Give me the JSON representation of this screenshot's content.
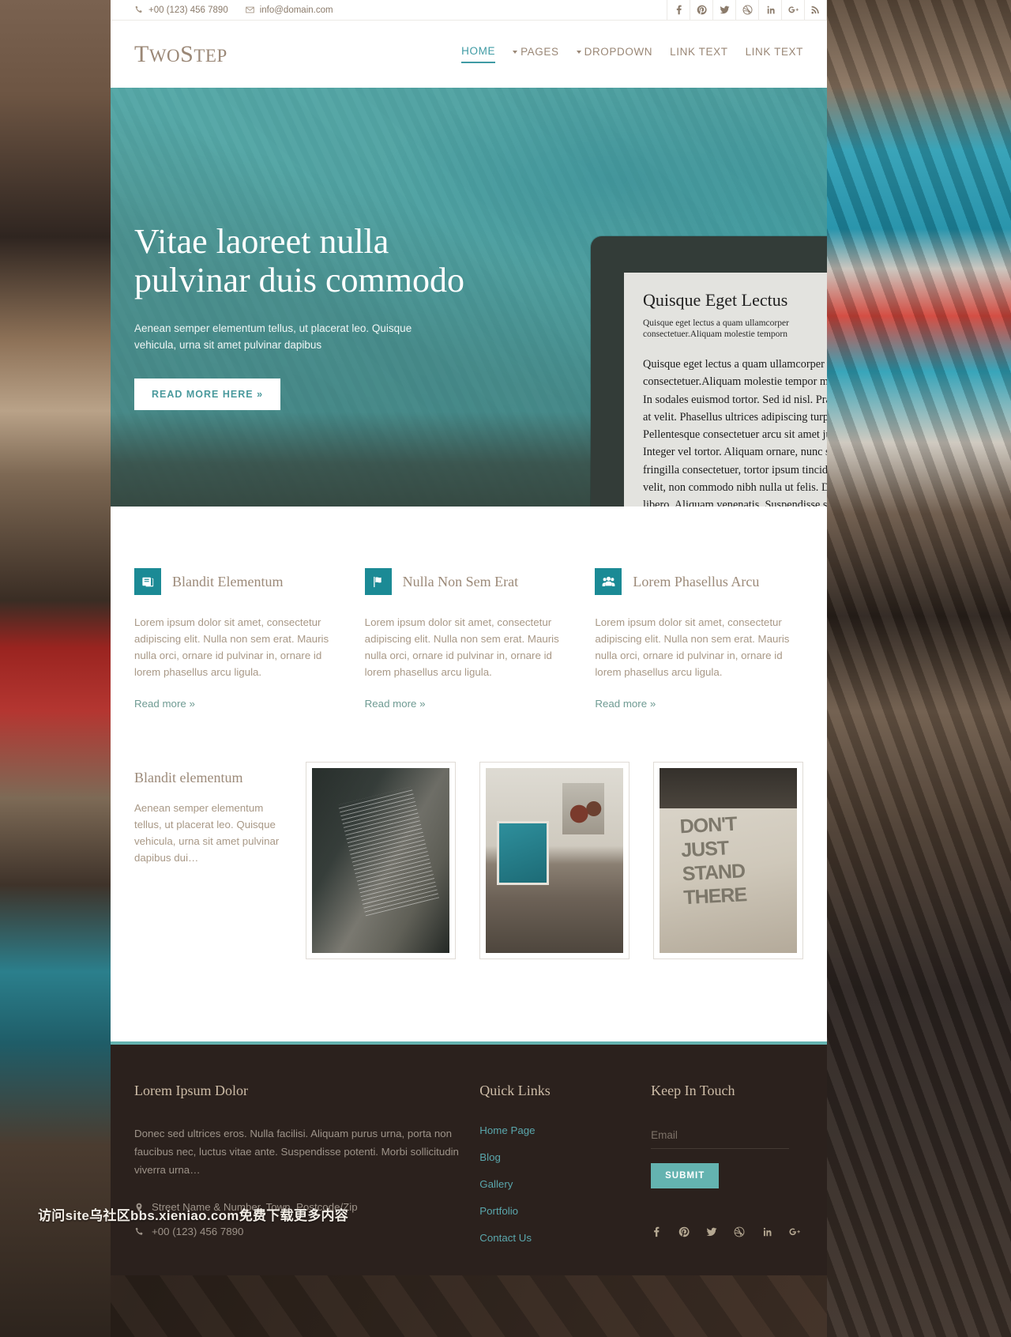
{
  "topbar": {
    "phone": "+00 (123) 456 7890",
    "email": "info@domain.com",
    "social": [
      "facebook-icon",
      "pinterest-icon",
      "twitter-icon",
      "dribbble-icon",
      "linkedin-icon",
      "googleplus-icon",
      "rss-icon"
    ]
  },
  "header": {
    "logo_first": "T",
    "logo_first_rest": "WO",
    "logo_second": "S",
    "logo_second_rest": "TEP",
    "nav": [
      {
        "label": "HOME",
        "active": true,
        "caret": false
      },
      {
        "label": "PAGES",
        "active": false,
        "caret": true
      },
      {
        "label": "DROPDOWN",
        "active": false,
        "caret": true
      },
      {
        "label": "LINK TEXT",
        "active": false,
        "caret": false
      },
      {
        "label": "LINK TEXT",
        "active": false,
        "caret": false
      }
    ]
  },
  "hero": {
    "title": "Vitae laoreet nulla pulvinar duis commodo",
    "subtitle": "Aenean semper elementum tellus, ut placerat leo. Quisque vehicula, urna sit amet pulvinar dapibus",
    "cta": "READ MORE HERE »",
    "tablet": {
      "title": "Quisque Eget Lectus",
      "lead": "Quisque eget lectus a quam ullamcorper consectetuer.Aliquam molestie temporn",
      "body": "Quisque eget lectus a quam ullamcorper consectetuer.Aliquam molestie tempor mauris. In sodales euismod tortor. Sed id nisl. Praesent at velit. Phasellus ultrices adipiscing turpis. Pellentesque consectetuer arcu sit amet justo. Integer vel tortor. Aliquam ornare, nunc sed fringilla consectetuer, tortor ipsum tincidunt velit, non commodo nibh nulla ut felis. Duis libero. Aliquam venenatis. Suspendisse sed arcu et neque euismod tincidunt.Duis pede. Quisque pellentesque."
    }
  },
  "features": [
    {
      "icon": "book-icon",
      "title": "Blandit Elementum",
      "text": "Lorem ipsum dolor sit amet, consectetur adipiscing elit. Nulla non sem erat. Mauris nulla orci, ornare id pulvinar in, ornare id lorem phasellus arcu ligula.",
      "link": "Read more »"
    },
    {
      "icon": "flag-icon",
      "title": "Nulla Non Sem Erat",
      "text": "Lorem ipsum dolor sit amet, consectetur adipiscing elit. Nulla non sem erat. Mauris nulla orci, ornare id pulvinar in, ornare id lorem phasellus arcu ligula.",
      "link": "Read more »"
    },
    {
      "icon": "users-icon",
      "title": "Lorem Phasellus Arcu",
      "text": "Lorem ipsum dolor sit amet, consectetur adipiscing elit. Nulla non sem erat. Mauris nulla orci, ornare id pulvinar in, ornare id lorem phasellus arcu ligula.",
      "link": "Read more »"
    }
  ],
  "gallery": {
    "title": "Blandit elementum",
    "text": "Aenean semper elementum tellus, ut placerat leo. Quisque vehicula, urna sit amet pulvinar dapibus dui…",
    "items": [
      {
        "name": "ereader-in-hands-photo"
      },
      {
        "name": "desk-with-plants-photo"
      },
      {
        "name": "dont-just-stand-there-poster-photo"
      }
    ]
  },
  "footer": {
    "about": {
      "title": "Lorem Ipsum Dolor",
      "text": "Donec sed ultrices eros. Nulla facilisi. Aliquam purus urna, porta non faucibus nec, luctus vitae ante. Suspendisse potenti. Morbi sollicitudin viverra urna…",
      "address": "Street Name & Number, Town, Postcode/Zip",
      "phone": "+00 (123) 456 7890"
    },
    "quick_links": {
      "title": "Quick Links",
      "items": [
        "Home Page",
        "Blog",
        "Gallery",
        "Portfolio",
        "Contact Us"
      ]
    },
    "keep_in_touch": {
      "title": "Keep In Touch",
      "email_placeholder": "Email",
      "submit": "SUBMIT",
      "social": [
        "facebook-icon",
        "pinterest-icon",
        "twitter-icon",
        "dribbble-icon",
        "linkedin-icon",
        "googleplus-icon"
      ]
    }
  },
  "watermark": "访问site乌社区bbs.xieniao.com免费下载更多内容"
}
